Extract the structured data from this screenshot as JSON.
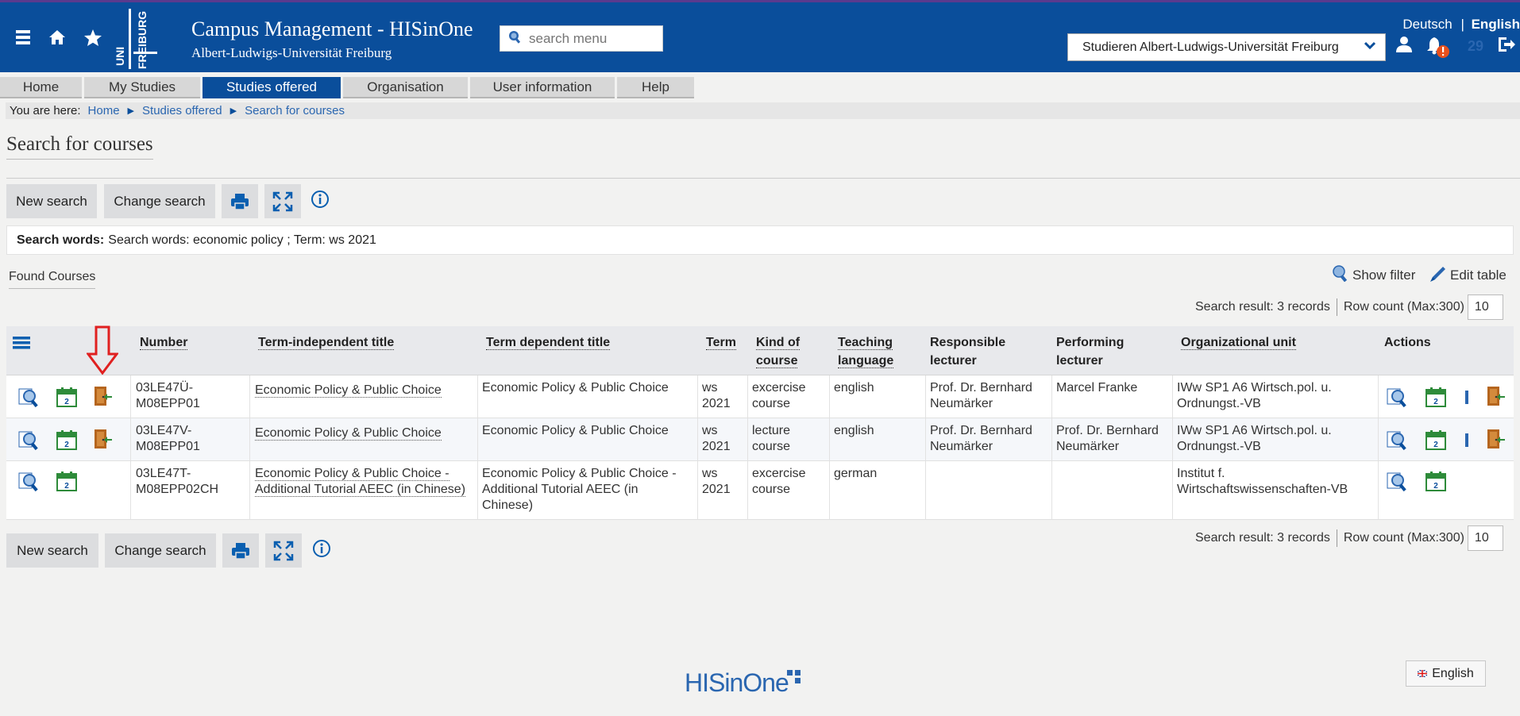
{
  "header": {
    "app_title": "Campus Management - HISinOne",
    "app_subtitle": "Albert-Ludwigs-Universität Freiburg",
    "search_placeholder": "search menu",
    "lang_deutsch": "Deutsch",
    "lang_sep": "|",
    "lang_english": "English",
    "org_select": "Studieren Albert-Ludwigs-Universität Freiburg",
    "notification_count": "29",
    "logo_text_a": "UNI",
    "logo_text_b": "FREIBURG"
  },
  "nav": {
    "tabs": [
      "Home",
      "My Studies",
      "Studies offered",
      "Organisation",
      "User information",
      "Help"
    ],
    "active": "Studies offered"
  },
  "breadcrumb": {
    "prefix": "You are here:",
    "items": [
      "Home",
      "Studies offered",
      "Search for courses"
    ]
  },
  "page_title": "Search for courses",
  "toolbar": {
    "new_search": "New search",
    "change_search": "Change search"
  },
  "search_words": {
    "label": "Search words:",
    "value": "Search words: economic policy ;  Term: ws 2021"
  },
  "results": {
    "found_label": "Found Courses",
    "show_filter": "Show filter",
    "edit_table": "Edit table",
    "summary": "Search result: 3 records",
    "row_count_label": "Row count (Max:300)",
    "row_count": "10"
  },
  "table": {
    "columns": [
      "Number",
      "Term-independent title",
      "Term dependent title",
      "Term",
      "Kind of course",
      "Teaching language",
      "Responsible lecturer",
      "Performing lecturer",
      "Organizational unit",
      "Actions"
    ],
    "rows": [
      {
        "number": "03LE47Ü-M08EPP01",
        "title_indep": "Economic Policy & Public Choice",
        "title_dep": "Economic Policy & Public Choice",
        "term": "ws 2021",
        "kind": "excercise course",
        "language": "english",
        "responsible": "Prof. Dr. Bernhard Neumärker",
        "performing": "Marcel Franke",
        "org_unit": "IWw SP1 A6 Wirtsch.pol. u. Ordnungst.-VB"
      },
      {
        "number": "03LE47V-M08EPP01",
        "title_indep": "Economic Policy & Public Choice",
        "title_dep": "Economic Policy & Public Choice",
        "term": "ws 2021",
        "kind": "lecture course",
        "language": "english",
        "responsible": "Prof. Dr. Bernhard Neumärker",
        "performing": "Prof. Dr. Bernhard Neumärker",
        "org_unit": "IWw SP1 A6 Wirtsch.pol. u. Ordnungst.-VB"
      },
      {
        "number": "03LE47T-M08EPP02CH",
        "title_indep": "Economic Policy & Public Choice - Additional Tutorial AEEC (in Chinese)",
        "title_dep": "Economic Policy & Public Choice - Additional Tutorial AEEC (in Chinese)",
        "term": "ws 2021",
        "kind": "excercise course",
        "language": "german",
        "responsible": "",
        "performing": "",
        "org_unit": "Institut f. Wirtschaftswissenschaften-VB"
      }
    ],
    "calendar_badge": "2"
  },
  "footer": {
    "brand": "HISinOne",
    "language_button": "English"
  },
  "colors": {
    "header_blue": "#0a4e9b",
    "link_blue": "#2a66b0",
    "calendar_green": "#2e8b3a",
    "door_brown": "#b5651d",
    "arrow_red": "#e02020",
    "alert_orange": "#e8501c"
  }
}
